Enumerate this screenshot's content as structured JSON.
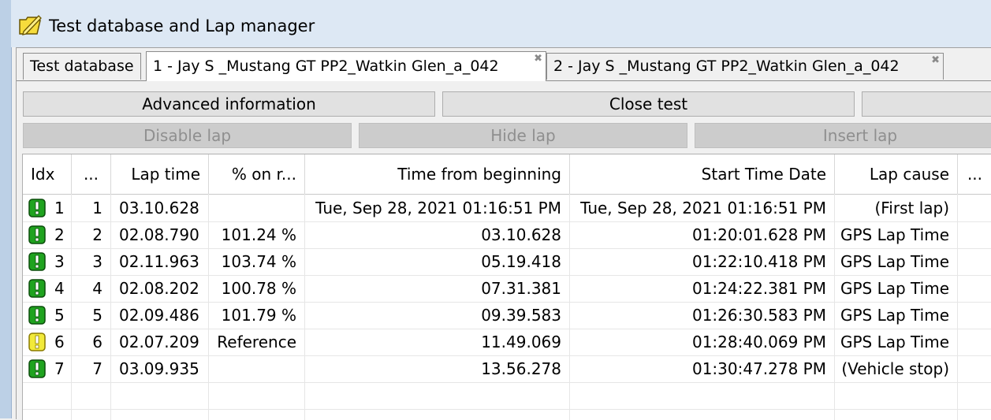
{
  "window": {
    "title": "Test database and Lap manager",
    "icon": "folder-pencil-icon"
  },
  "tabs": [
    {
      "label": "Test database",
      "closable": false
    },
    {
      "label": "1 - Jay S _Mustang GT PP2_Watkin Glen_a_042",
      "closable": true,
      "close_icon": "close-x-icon",
      "active": true
    },
    {
      "label": "2 - Jay S _Mustang GT PP2_Watkin Glen_a_042",
      "closable": true,
      "close_icon": "close-x-icon"
    }
  ],
  "buttons": {
    "advanced_information": "Advanced information",
    "close_test": "Close test",
    "disable_lap": "Disable lap",
    "hide_lap": "Hide lap",
    "insert_lap": "Insert lap"
  },
  "grid": {
    "columns": [
      "Idx",
      "...",
      "Lap time",
      "% on r...",
      "Time from beginning",
      "Start Time Date",
      "Lap cause",
      "..."
    ],
    "rows": [
      {
        "idx": "1",
        "num": "1",
        "lap_time": "03.10.628",
        "pct": "",
        "from_beginning": "Tue, Sep 28, 2021  01:16:51 PM",
        "start": "Tue, Sep 28, 2021  01:16:51 PM",
        "cause": "(First lap)",
        "flag": "green"
      },
      {
        "idx": "2",
        "num": "2",
        "lap_time": "02.08.790",
        "pct": "101.24 %",
        "from_beginning": "03.10.628",
        "start": "01:20:01.628 PM",
        "cause": "GPS Lap Time",
        "flag": "green"
      },
      {
        "idx": "3",
        "num": "3",
        "lap_time": "02.11.963",
        "pct": "103.74 %",
        "from_beginning": "05.19.418",
        "start": "01:22:10.418 PM",
        "cause": "GPS Lap Time",
        "flag": "green"
      },
      {
        "idx": "4",
        "num": "4",
        "lap_time": "02.08.202",
        "pct": "100.78 %",
        "from_beginning": "07.31.381",
        "start": "01:24:22.381 PM",
        "cause": "GPS Lap Time",
        "flag": "green"
      },
      {
        "idx": "5",
        "num": "5",
        "lap_time": "02.09.486",
        "pct": "101.79 %",
        "from_beginning": "09.39.583",
        "start": "01:26:30.583 PM",
        "cause": "GPS Lap Time",
        "flag": "green"
      },
      {
        "idx": "6",
        "num": "6",
        "lap_time": "02.07.209",
        "pct": "Reference",
        "from_beginning": "11.49.069",
        "start": "01:28:40.069 PM",
        "cause": "GPS Lap Time",
        "flag": "yellow"
      },
      {
        "idx": "7",
        "num": "7",
        "lap_time": "03.09.935",
        "pct": "",
        "from_beginning": "13.56.278",
        "start": "01:30:47.278 PM",
        "cause": "(Vehicle stop)",
        "flag": "green"
      }
    ]
  },
  "colors": {
    "flag_green": "#1fa31f",
    "flag_yellow": "#f2ea3a",
    "titlebar": "#dde8f4"
  }
}
